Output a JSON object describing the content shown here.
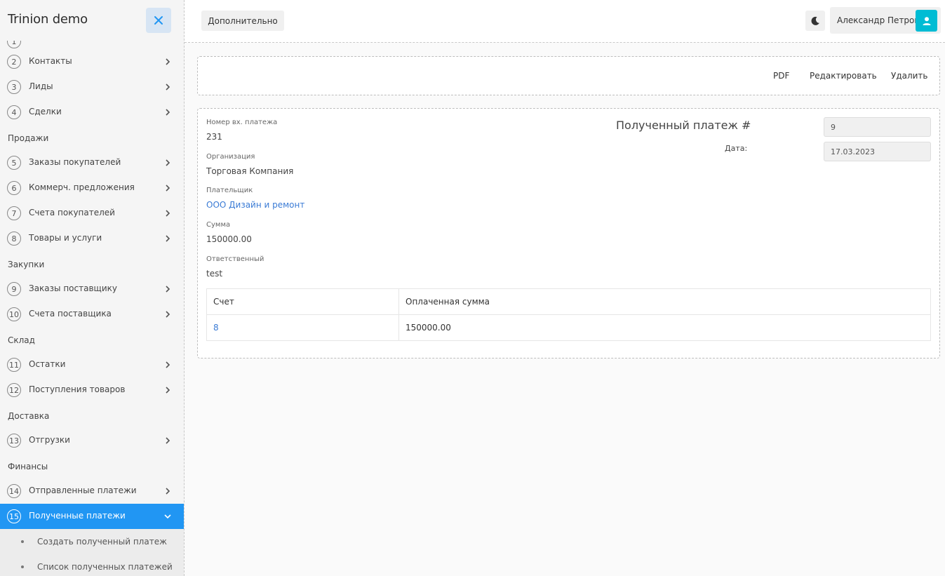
{
  "sidebar": {
    "brand": "Trinion demo",
    "partial_number": "1",
    "items_group1": [
      {
        "num": "2",
        "label": "Контакты"
      },
      {
        "num": "3",
        "label": "Лиды"
      },
      {
        "num": "4",
        "label": "Сделки"
      }
    ],
    "section_sales": "Продажи",
    "items_sales": [
      {
        "num": "5",
        "label": "Заказы покупателей"
      },
      {
        "num": "6",
        "label": "Коммерч. предложения"
      },
      {
        "num": "7",
        "label": "Счета покупателей"
      },
      {
        "num": "8",
        "label": "Товары и услуги"
      }
    ],
    "section_purchases": "Закупки",
    "items_purchases": [
      {
        "num": "9",
        "label": "Заказы поставщику"
      },
      {
        "num": "10",
        "label": "Счета поставщика"
      }
    ],
    "section_warehouse": "Склад",
    "items_warehouse": [
      {
        "num": "11",
        "label": "Остатки"
      },
      {
        "num": "12",
        "label": "Поступления товаров"
      }
    ],
    "section_delivery": "Доставка",
    "items_delivery": [
      {
        "num": "13",
        "label": "Отгрузки"
      }
    ],
    "section_finance": "Финансы",
    "items_finance": [
      {
        "num": "14",
        "label": "Отправленные платежи"
      },
      {
        "num": "15",
        "label": "Полученные платежи"
      }
    ],
    "sub_items": [
      {
        "label": "Создать полученный платеж"
      },
      {
        "label": "Список полученных платежей"
      }
    ]
  },
  "topbar": {
    "more_label": "Дополнительно",
    "user_name": "Александр Петров"
  },
  "actions": {
    "pdf": "PDF",
    "edit": "Редактировать",
    "delete": "Удалить"
  },
  "detail": {
    "title": "Полученный платеж #",
    "number_value": "9",
    "date_label": "Дата:",
    "date_value": "17.03.2023",
    "fields": [
      {
        "label": "Номер вх. платежа",
        "value": "231"
      },
      {
        "label": "Организация",
        "value": "Торговая Компания"
      },
      {
        "label": "Плательщик",
        "value": "ООО Дизайн и ремонт"
      },
      {
        "label": "Сумма",
        "value": "150000.00"
      },
      {
        "label": "Ответственный",
        "value": "test"
      }
    ],
    "table": {
      "headers": [
        "Счет",
        "Оплаченная сумма"
      ],
      "rows": [
        [
          "8",
          "150000.00"
        ]
      ]
    }
  },
  "colors": {
    "accent": "#2196f3",
    "avatar": "#00bcd4",
    "link": "#3a7bd5"
  }
}
